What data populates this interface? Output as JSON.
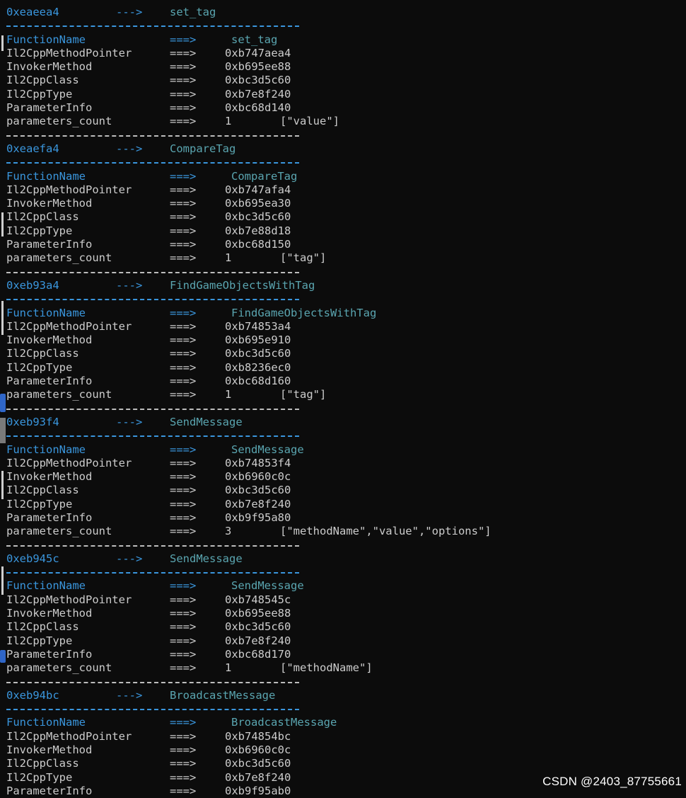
{
  "watermark": "CSDN @2403_87755661",
  "labels": {
    "function_name": "FunctionName",
    "method_pointer": "Il2CppMethodPointer",
    "invoker": "InvokerMethod",
    "klass": "Il2CppClass",
    "type": "Il2CppType",
    "param_info": "ParameterInfo",
    "param_count": "parameters_count"
  },
  "arrows": {
    "header": "--->",
    "field": "===>"
  },
  "blocks": [
    {
      "address": "0xeaeea4",
      "name": "set_tag",
      "method_pointer": "0xb747aea4",
      "invoker": "0xb695ee88",
      "klass": "0xbc3d5c60",
      "type": "0xb7e8f240",
      "param_info": "0xbc68d140",
      "param_count": "1",
      "param_names": "[\"value\"]"
    },
    {
      "address": "0xeaefa4",
      "name": "CompareTag",
      "method_pointer": "0xb747afa4",
      "invoker": "0xb695ea30",
      "klass": "0xbc3d5c60",
      "type": "0xb7e88d18",
      "param_info": "0xbc68d150",
      "param_count": "1",
      "param_names": "[\"tag\"]"
    },
    {
      "address": "0xeb93a4",
      "name": "FindGameObjectsWithTag",
      "method_pointer": "0xb74853a4",
      "invoker": "0xb695e910",
      "klass": "0xbc3d5c60",
      "type": "0xb8236ec0",
      "param_info": "0xbc68d160",
      "param_count": "1",
      "param_names": "[\"tag\"]"
    },
    {
      "address": "0xeb93f4",
      "name": "SendMessage",
      "method_pointer": "0xb74853f4",
      "invoker": "0xb6960c0c",
      "klass": "0xbc3d5c60",
      "type": "0xb7e8f240",
      "param_info": "0xb9f95a80",
      "param_count": "3",
      "param_names": "[\"methodName\",\"value\",\"options\"]"
    },
    {
      "address": "0xeb945c",
      "name": "SendMessage",
      "method_pointer": "0xb748545c",
      "invoker": "0xb695ee88",
      "klass": "0xbc3d5c60",
      "type": "0xb7e8f240",
      "param_info": "0xbc68d170",
      "param_count": "1",
      "param_names": "[\"methodName\"]"
    },
    {
      "address": "0xeb94bc",
      "name": "BroadcastMessage",
      "method_pointer": "0xb74854bc",
      "invoker": "0xb6960c0c",
      "klass": "0xbc3d5c60",
      "type": "0xb7e8f240",
      "param_info": "0xb9f95ab0",
      "param_count": "",
      "param_names": ""
    }
  ]
}
